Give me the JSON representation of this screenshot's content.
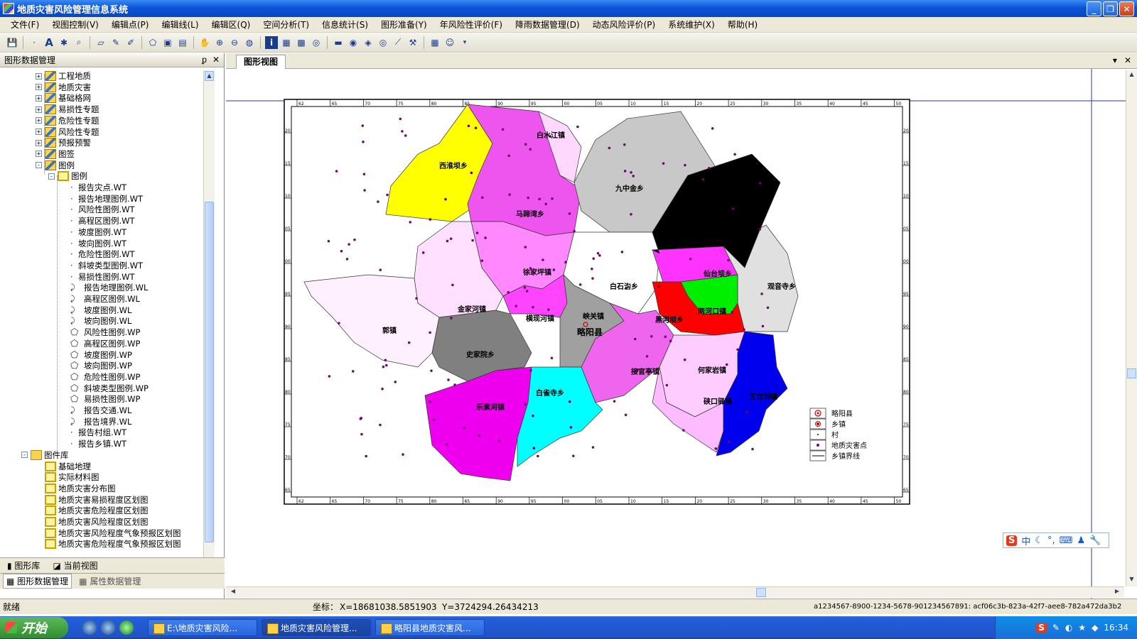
{
  "window": {
    "title": "地质灾害风险管理信息系统"
  },
  "menu": [
    "文件(F)",
    "视图控制(V)",
    "编辑点(P)",
    "编辑线(L)",
    "编辑区(Q)",
    "空间分析(T)",
    "信息统计(S)",
    "图形准备(Y)",
    "年风险性评价(F)",
    "降雨数据管理(D)",
    "动态风险评价(P)",
    "系统维护(X)",
    "帮助(H)"
  ],
  "left_panel": {
    "title": "图形数据管理",
    "tree": [
      {
        "label": "工程地质",
        "level": 2,
        "icon": "layer",
        "toggle": "+"
      },
      {
        "label": "地质灾害",
        "level": 2,
        "icon": "layer",
        "toggle": "+"
      },
      {
        "label": "基础格网",
        "level": 2,
        "icon": "layer",
        "toggle": "+"
      },
      {
        "label": "易损性专题",
        "level": 2,
        "icon": "layer",
        "toggle": "+"
      },
      {
        "label": "危险性专题",
        "level": 2,
        "icon": "layer",
        "toggle": "+"
      },
      {
        "label": "风险性专题",
        "level": 2,
        "icon": "layer",
        "toggle": "+"
      },
      {
        "label": "预报预警",
        "level": 2,
        "icon": "layer",
        "toggle": "+"
      },
      {
        "label": "图签",
        "level": 2,
        "icon": "layer",
        "toggle": "+"
      },
      {
        "label": "图例",
        "level": 2,
        "icon": "layer",
        "toggle": "-"
      },
      {
        "label": "图例",
        "level": 3,
        "icon": "grp",
        "toggle": "-"
      },
      {
        "label": "报告灾点.WT",
        "level": 4,
        "icon": "pt"
      },
      {
        "label": "报告地理图例.WT",
        "level": 4,
        "icon": "pt"
      },
      {
        "label": "风险性图例.WT",
        "level": 4,
        "icon": "pt"
      },
      {
        "label": "高程区图例.WT",
        "level": 4,
        "icon": "pt"
      },
      {
        "label": "坡度图例.WT",
        "level": 4,
        "icon": "pt"
      },
      {
        "label": "坡向图例.WT",
        "level": 4,
        "icon": "pt"
      },
      {
        "label": "危险性图例.WT",
        "level": 4,
        "icon": "pt"
      },
      {
        "label": "斜坡类型图例.WT",
        "level": 4,
        "icon": "pt"
      },
      {
        "label": "易损性图例.WT",
        "level": 4,
        "icon": "pt"
      },
      {
        "label": "报告地理图例.WL",
        "level": 4,
        "icon": "ln"
      },
      {
        "label": "高程区图例.WL",
        "level": 4,
        "icon": "ln"
      },
      {
        "label": "坡度图例.WL",
        "level": 4,
        "icon": "ln"
      },
      {
        "label": "坡向图例.WL",
        "level": 4,
        "icon": "ln"
      },
      {
        "label": "风险性图例.WP",
        "level": 4,
        "icon": "pg"
      },
      {
        "label": "高程区图例.WP",
        "level": 4,
        "icon": "pg"
      },
      {
        "label": "坡度图例.WP",
        "level": 4,
        "icon": "pg"
      },
      {
        "label": "坡向图例.WP",
        "level": 4,
        "icon": "pg"
      },
      {
        "label": "危险性图例.WP",
        "level": 4,
        "icon": "pg"
      },
      {
        "label": "斜坡类型图例.WP",
        "level": 4,
        "icon": "pg"
      },
      {
        "label": "易损性图例.WP",
        "level": 4,
        "icon": "pg"
      },
      {
        "label": "报告交通.WL",
        "level": 4,
        "icon": "ln"
      },
      {
        "label": "报告境界.WL",
        "level": 4,
        "icon": "ln"
      },
      {
        "label": "报告村组.WT",
        "level": 4,
        "icon": "pt"
      },
      {
        "label": "报告乡镇.WT",
        "level": 4,
        "icon": "pt"
      },
      {
        "label": "图件库",
        "level": 1,
        "icon": "folder",
        "toggle": "-"
      },
      {
        "label": "基础地理",
        "level": 2,
        "icon": "grp"
      },
      {
        "label": "实际材料图",
        "level": 2,
        "icon": "grp"
      },
      {
        "label": "地质灾害分布图",
        "level": 2,
        "icon": "grp"
      },
      {
        "label": "地质灾害易损程度区划图",
        "level": 2,
        "icon": "grp"
      },
      {
        "label": "地质灾害危险程度区划图",
        "level": 2,
        "icon": "grp"
      },
      {
        "label": "地质灾害风险程度区划图",
        "level": 2,
        "icon": "grp"
      },
      {
        "label": "地质灾害风险程度气象预报区划图",
        "level": 2,
        "icon": "grp"
      },
      {
        "label": "地质灾害危险程度气象预报区划图",
        "level": 2,
        "icon": "grp"
      }
    ],
    "tabs_top": [
      "图形库",
      "当前视图"
    ],
    "tabs_bottom": [
      "图形数据管理",
      "属性数据管理"
    ]
  },
  "map_view": {
    "tab": "图形视图",
    "regions": [
      {
        "name": "西淮坝乡",
        "color": "#ffff00"
      },
      {
        "name": "白水江镇",
        "color": "#ffd8ff"
      },
      {
        "name": "马蹄湾乡",
        "color": "#ee55ee"
      },
      {
        "name": "九中金乡",
        "color": "#c8c8c8"
      },
      {
        "name": "徐家坪镇",
        "color": "#ff88ff"
      },
      {
        "name": "白石沟乡",
        "color": "#ffffff"
      },
      {
        "name": "仙台坝乡",
        "color": "#ff33ff"
      },
      {
        "name": "观音寺乡",
        "color": "#e0e0e0"
      },
      {
        "name": "金家河镇",
        "color": "#ffe0ff"
      },
      {
        "name": "横现河镇",
        "color": "#ff44ff"
      },
      {
        "name": "峡关镇",
        "color": "#a0a0a0"
      },
      {
        "name": "黑河坝乡",
        "color": "#ff0000"
      },
      {
        "name": "两河口镇",
        "color": "#00ee00"
      },
      {
        "name": "郭镇",
        "color": "#fff0ff"
      },
      {
        "name": "史家院乡",
        "color": "#808080"
      },
      {
        "name": "接官亭镇",
        "color": "#ee66ee"
      },
      {
        "name": "何家岩镇",
        "color": "#ffccff"
      },
      {
        "name": "乐素河镇",
        "color": "#ee00ee"
      },
      {
        "name": "白雀寺乡",
        "color": "#00ffff"
      },
      {
        "name": "硖口驿镇",
        "color": "#ffbbff"
      },
      {
        "name": "五龙洞镇",
        "color": "#0000ee"
      }
    ],
    "county_label": "略阳县",
    "top_ticks": [
      "62",
      "65",
      "70",
      "75",
      "80",
      "85",
      "90",
      "95",
      "00",
      "05",
      "10",
      "15",
      "20",
      "25",
      "30",
      "35",
      "40",
      "45",
      "50"
    ],
    "bottom_ticks": [
      "62",
      "65",
      "70",
      "75",
      "80",
      "85",
      "90",
      "95",
      "00",
      "05",
      "10",
      "15",
      "20",
      "25",
      "30",
      "35",
      "40",
      "45",
      "50"
    ],
    "side_ticks": [
      "20",
      "15",
      "10",
      "05",
      "00",
      "95",
      "90",
      "85",
      "80",
      "75",
      "70",
      "65"
    ],
    "legend": [
      {
        "symbol": "county",
        "label": "略阳县"
      },
      {
        "symbol": "town",
        "label": "乡镇"
      },
      {
        "symbol": "village",
        "label": "村"
      },
      {
        "symbol": "hazard",
        "label": "地质灾害点"
      },
      {
        "symbol": "boundary",
        "label": "乡镇界线"
      }
    ]
  },
  "status": {
    "left": "就绪",
    "coord_label": "坐标：",
    "x": "X=18681038.5851903",
    "y": "Y=3724294.26434213",
    "id": "a1234567-8900-1234-5678-901234567891: acf06c3b-823a-42f7-aee8-782a472da3b2"
  },
  "taskbar": {
    "start": "开始",
    "tasks": [
      "E:\\地质灾害风险...",
      "地质灾害风险管理...",
      "略阳县地质灾害风..."
    ],
    "clock": "16:34"
  },
  "ime": {
    "label": "中"
  }
}
